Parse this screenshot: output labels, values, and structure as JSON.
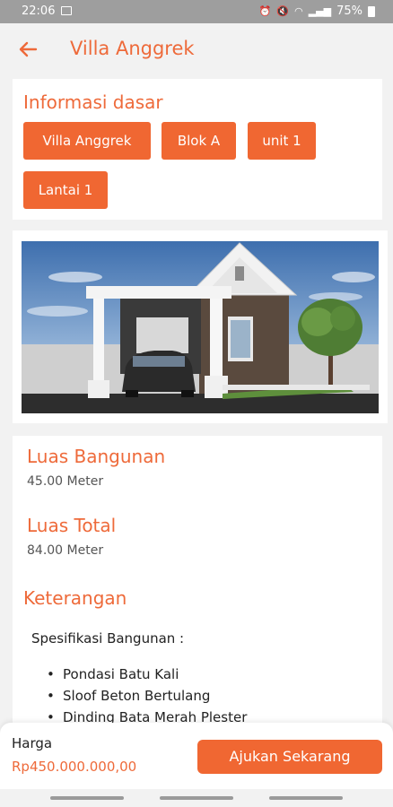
{
  "status_bar": {
    "time": "22:06",
    "battery_pct": "75%",
    "icons": [
      "gallery-icon",
      "alarm-icon",
      "mute-icon",
      "wifi-icon",
      "signal-icon",
      "battery-icon"
    ]
  },
  "app_bar": {
    "title": "Villa Anggrek",
    "back_icon": "arrow-left-icon"
  },
  "info": {
    "section_title": "Informasi dasar",
    "chips": [
      "Villa Anggrek",
      "Blok A",
      "unit 1",
      "Lantai 1"
    ]
  },
  "details": {
    "building_area_label": "Luas Bangunan",
    "building_area_value": "45.00 Meter",
    "total_area_label": "Luas Total",
    "total_area_value": "84.00 Meter",
    "description_label": "Keterangan",
    "spec_heading": "Spesifikasi Bangunan :",
    "spec_items": [
      "Pondasi Batu Kali",
      "Sloof Beton Bertulang",
      "Dinding Bata Merah Plester"
    ]
  },
  "bottom": {
    "price_label": "Harga",
    "price_value": "Rp450.000.000,00",
    "submit_label": "Ajukan Sekarang"
  },
  "colors": {
    "accent": "#f06732",
    "status_bar": "#9e9e9e",
    "background": "#f2f2f2"
  }
}
